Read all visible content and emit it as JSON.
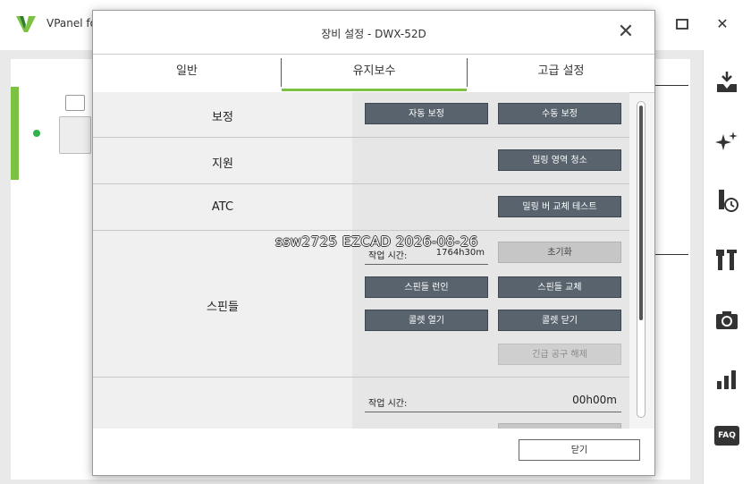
{
  "app": {
    "title": "VPanel for",
    "maximize_glyph": "☐",
    "close_glyph": "✕"
  },
  "rail_icons": [
    "milling-icon",
    "sparkle-icon",
    "tool-clock-icon",
    "wrench-icon",
    "camera-icon",
    "bar-chart-icon",
    "faq-icon"
  ],
  "rail_faq_text": "FAQ",
  "dialog": {
    "title": "장비 설정 - DWX-52D",
    "close_glyph": "✕",
    "tabs": [
      {
        "label": "일반"
      },
      {
        "label": "유지보수",
        "active": true
      },
      {
        "label": "고급 설정"
      }
    ],
    "sections": {
      "calibration": {
        "label": "보정",
        "auto_button": "자동 보정",
        "manual_button": "수동 보정"
      },
      "support": {
        "label": "지원",
        "clean_button": "밀링 영역 청소"
      },
      "atc": {
        "label": "ATC",
        "test_button": "밀링 버 교체 테스트"
      },
      "spindle": {
        "label": "스핀들",
        "work_time_label": "작업 시간:",
        "work_time_value": "1764h30m",
        "reset_button": "초기화",
        "run_in_button": "스핀들 런인",
        "replace_button": "스핀들 교체",
        "collet_open_button": "콜렛 열기",
        "collet_close_button": "콜렛 닫기",
        "emergency_release_button": "긴급 공구 해제"
      },
      "next": {
        "work_time_label": "작업 시간:",
        "work_time_value": "00h00m"
      }
    },
    "footer": {
      "close_button": "닫기"
    }
  },
  "watermark": "ssw2725 EZCAD 2026-08-26",
  "colors": {
    "accent_green": "#7cc242",
    "button_dark": "#58636d",
    "status_dot": "#2fb24a"
  }
}
